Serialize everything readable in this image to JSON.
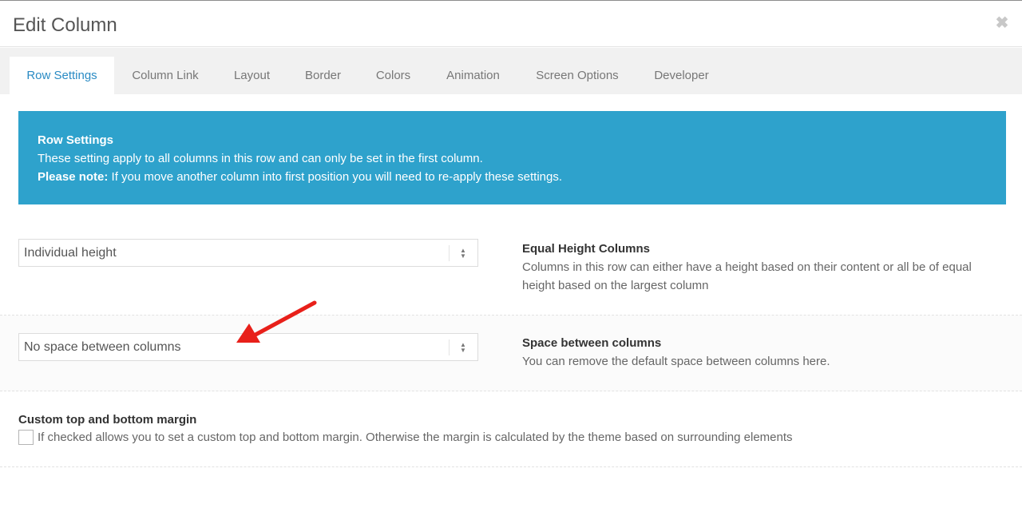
{
  "dialog": {
    "title": "Edit Column",
    "close_icon": "close-icon"
  },
  "tabs": [
    {
      "label": "Row Settings",
      "active": true
    },
    {
      "label": "Column Link",
      "active": false
    },
    {
      "label": "Layout",
      "active": false
    },
    {
      "label": "Border",
      "active": false
    },
    {
      "label": "Colors",
      "active": false
    },
    {
      "label": "Animation",
      "active": false
    },
    {
      "label": "Screen Options",
      "active": false
    },
    {
      "label": "Developer",
      "active": false
    }
  ],
  "info": {
    "heading": "Row Settings",
    "line1": "These setting apply to all columns in this row and can only be set in the first column.",
    "note_label": "Please note:",
    "note_text": " If you move another column into first position you will need to re-apply these settings.",
    "background_color": "#2ea2cc"
  },
  "equal_height": {
    "selected": "Individual height",
    "title": "Equal Height Columns",
    "description": "Columns in this row can either have a height based on their content or all be of equal height based on the largest column"
  },
  "spacing": {
    "selected": "No space between columns",
    "title": "Space between columns",
    "description": "You can remove the default space between columns here."
  },
  "margin": {
    "title": "Custom top and bottom margin",
    "checked": false,
    "description": "If checked allows you to set a custom top and bottom margin. Otherwise the margin is calculated by the theme based on surrounding elements"
  },
  "annotation": {
    "icon": "red-arrow-icon",
    "color": "#e8201a"
  },
  "colors": {
    "accent": "#2a8bc4",
    "tab_bar": "#f1f1f1"
  }
}
